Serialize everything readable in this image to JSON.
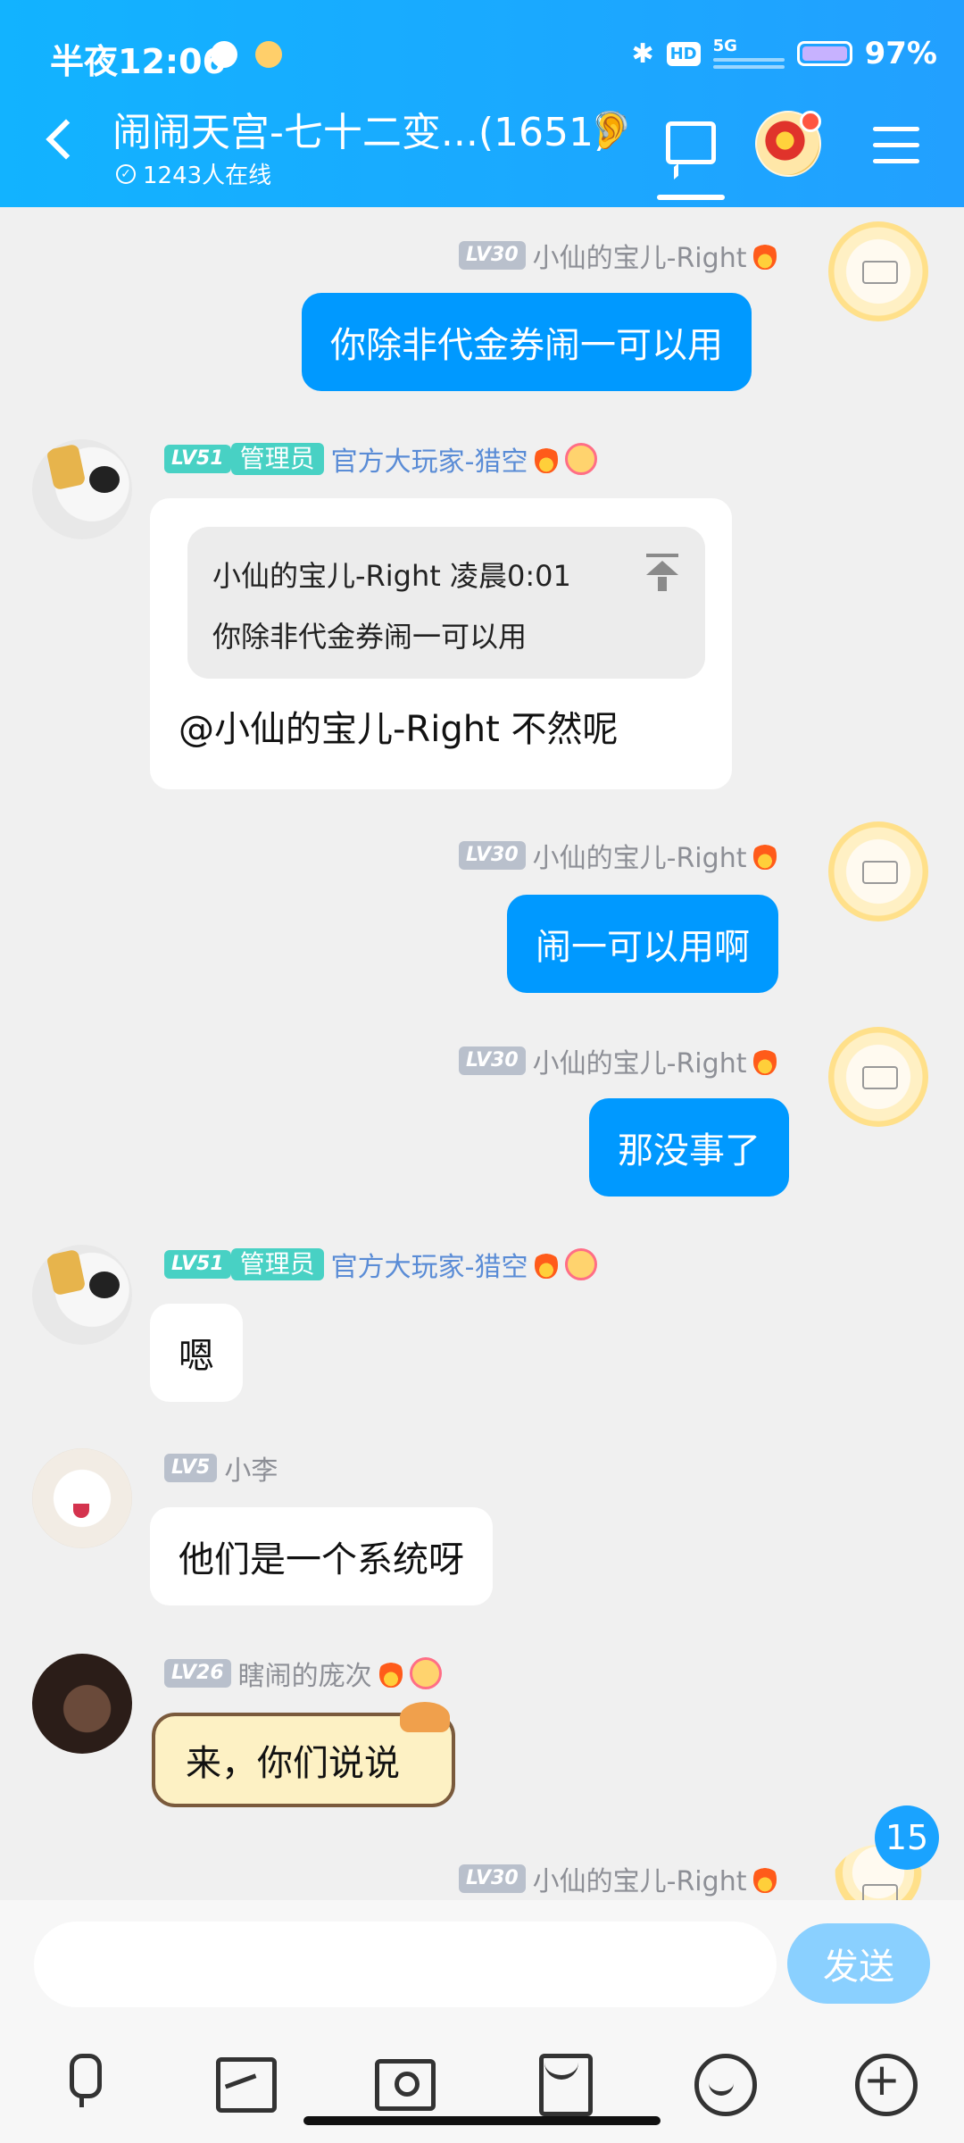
{
  "status_bar": {
    "time": "半夜12:06",
    "network": "5G",
    "hd": "HD",
    "battery": "97%"
  },
  "header": {
    "title": "闹闹天宫-七十二变...(1651)",
    "online": "1243人在线",
    "accent": "#12b3ff"
  },
  "messages": [
    {
      "id": "m1",
      "level": "LV30",
      "name": "小仙的宝儿-Right",
      "text": "你除非代金券闹一可以用",
      "side": "out"
    },
    {
      "id": "m2",
      "level": "LV51",
      "role": "管理员",
      "name": "官方大玩家-猎空",
      "quote": {
        "header": "小仙的宝儿-Right 凌晨0:01",
        "text": "你除非代金券闹一可以用"
      },
      "text": "@小仙的宝儿-Right 不然呢",
      "side": "in"
    },
    {
      "id": "m3",
      "level": "LV30",
      "name": "小仙的宝儿-Right",
      "text": "闹一可以用啊",
      "side": "out"
    },
    {
      "id": "m4",
      "level": "LV30",
      "name": "小仙的宝儿-Right",
      "text": "那没事了",
      "side": "out"
    },
    {
      "id": "m5",
      "level": "LV51",
      "role": "管理员",
      "name": "官方大玩家-猎空",
      "text": "嗯",
      "side": "in"
    },
    {
      "id": "m6",
      "level": "LV5",
      "name": "小李",
      "text": "他们是一个系统呀",
      "side": "in"
    },
    {
      "id": "m7",
      "level": "LV26",
      "name": "瞎闹的庞次",
      "text": "来，你们说说",
      "side": "in"
    },
    {
      "id": "m8",
      "level": "LV30",
      "name": "小仙的宝儿-Right",
      "side": "out"
    }
  ],
  "unread_badge": "15",
  "composer": {
    "placeholder": "",
    "send_label": "发送",
    "tools": [
      "mic-icon",
      "image-icon",
      "camera-icon",
      "red-packet-icon",
      "emoji-icon",
      "plus-icon"
    ]
  }
}
